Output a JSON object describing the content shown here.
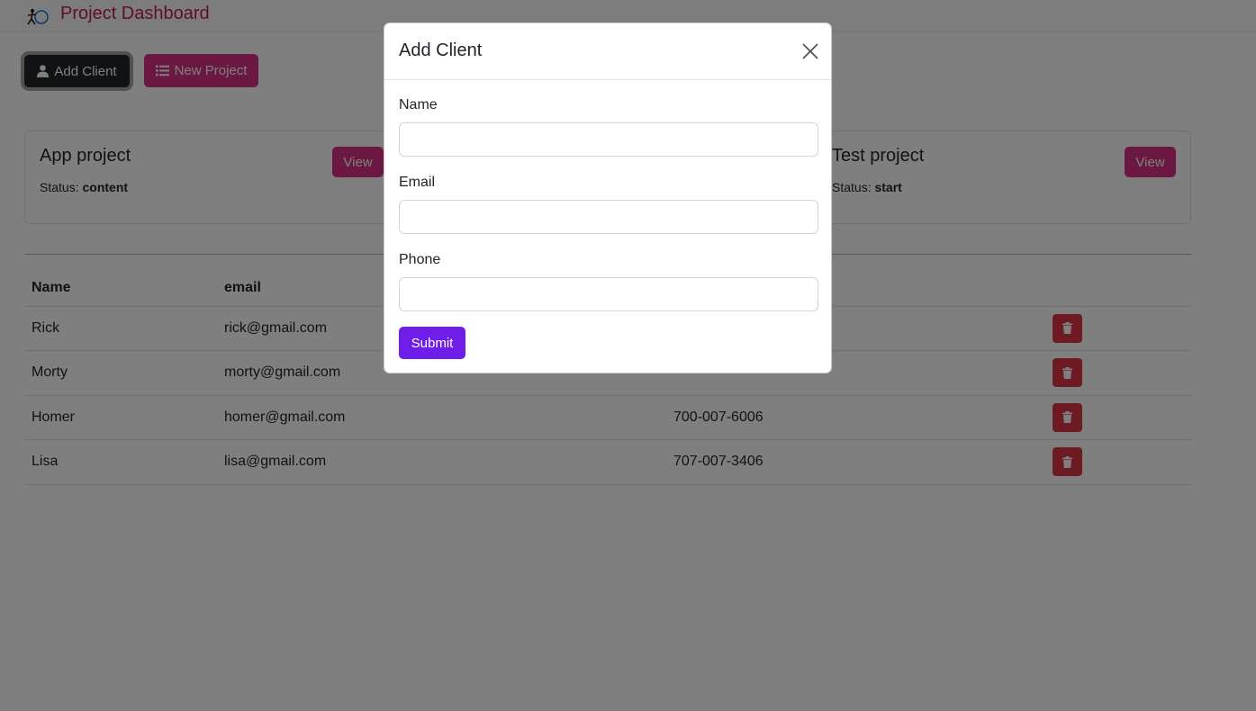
{
  "app": {
    "title": "Project Dashboard",
    "logo_icon": "logo-icon"
  },
  "toolbar": {
    "add_client_label": "Add Client",
    "new_project_label": "New Project"
  },
  "projects": [
    {
      "name": "App project",
      "status_label": "Status:",
      "status": "content",
      "view_label": "View"
    },
    {
      "name": "Test project",
      "status_label": "Status:",
      "status": "start",
      "view_label": "View"
    }
  ],
  "clients_table": {
    "headers": {
      "name": "Name",
      "email": "email",
      "phone": ""
    },
    "rows": [
      {
        "name": "Rick",
        "email": "rick@gmail.com",
        "phone": ""
      },
      {
        "name": "Morty",
        "email": "morty@gmail.com",
        "phone": ""
      },
      {
        "name": "Homer",
        "email": "homer@gmail.com",
        "phone": "700-007-6006"
      },
      {
        "name": "Lisa",
        "email": "lisa@gmail.com",
        "phone": "707-007-3406"
      }
    ]
  },
  "modal": {
    "title": "Add Client",
    "name_label": "Name",
    "name_value": "",
    "email_label": "Email",
    "email_value": "",
    "phone_label": "Phone",
    "phone_value": "",
    "submit_label": "Submit"
  },
  "colors": {
    "brand": "#c2185b",
    "pink_button": "#d63384",
    "dark_button": "#212529",
    "delete_button": "#dc3545",
    "submit_button": "#6f1ee9"
  }
}
